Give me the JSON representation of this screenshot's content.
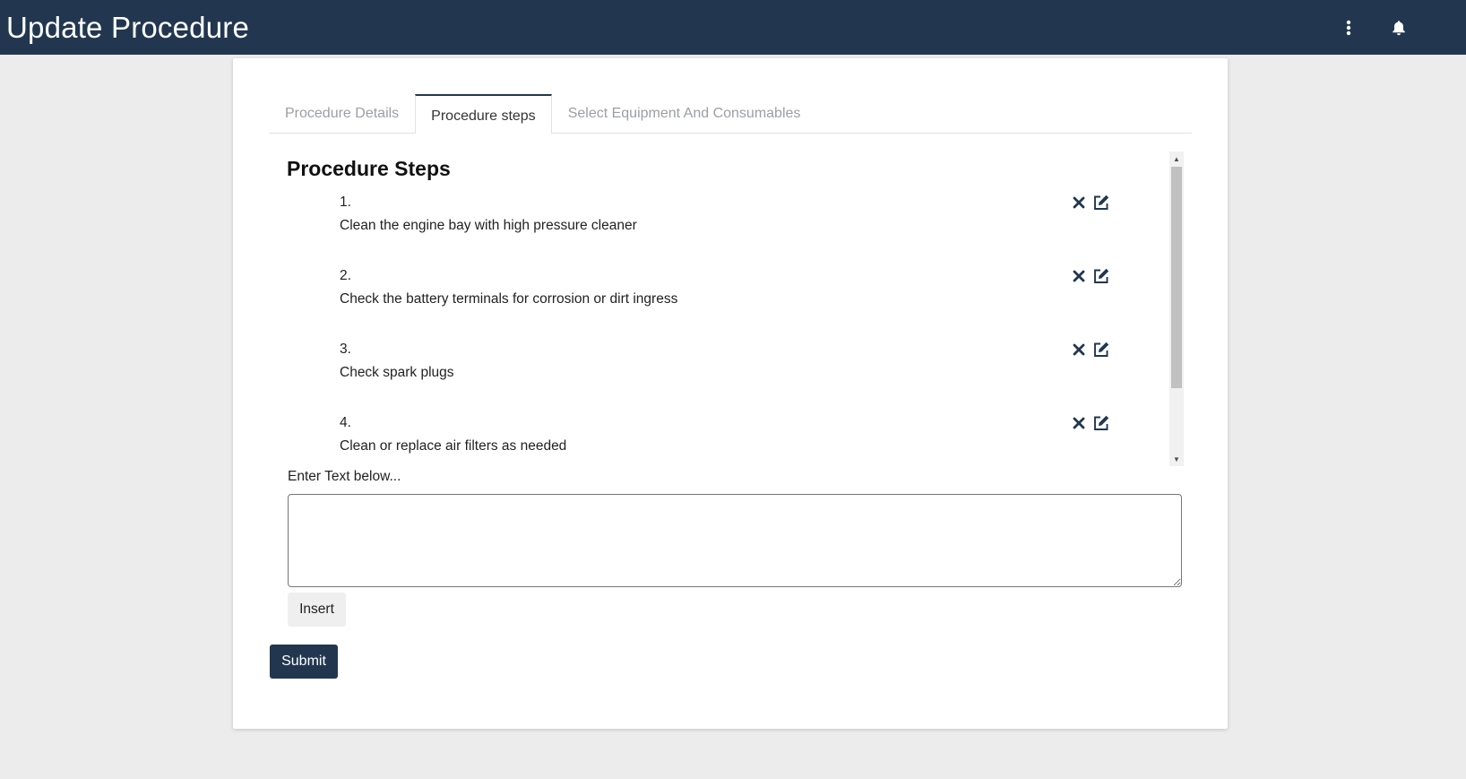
{
  "header": {
    "title": "Update Procedure",
    "menu_icon": "vertical-dots-icon",
    "notification_icon": "bell-icon"
  },
  "tabs": [
    {
      "label": "Procedure Details",
      "active": false
    },
    {
      "label": "Procedure steps",
      "active": true
    },
    {
      "label": "Select Equipment And Consumables",
      "active": false
    }
  ],
  "steps_section": {
    "heading": "Procedure Steps",
    "steps": [
      {
        "number": "1.",
        "text": "Clean the engine bay with high pressure cleaner"
      },
      {
        "number": "2.",
        "text": "Check the battery terminals for corrosion or dirt ingress"
      },
      {
        "number": "3.",
        "text": "Check spark plugs"
      },
      {
        "number": "4.",
        "text": "Clean or replace air filters as needed"
      }
    ]
  },
  "editor": {
    "label": "Enter Text below...",
    "value": "",
    "insert_label": "Insert"
  },
  "submit_label": "Submit",
  "colors": {
    "primary": "#22374f",
    "background": "#ececec"
  }
}
